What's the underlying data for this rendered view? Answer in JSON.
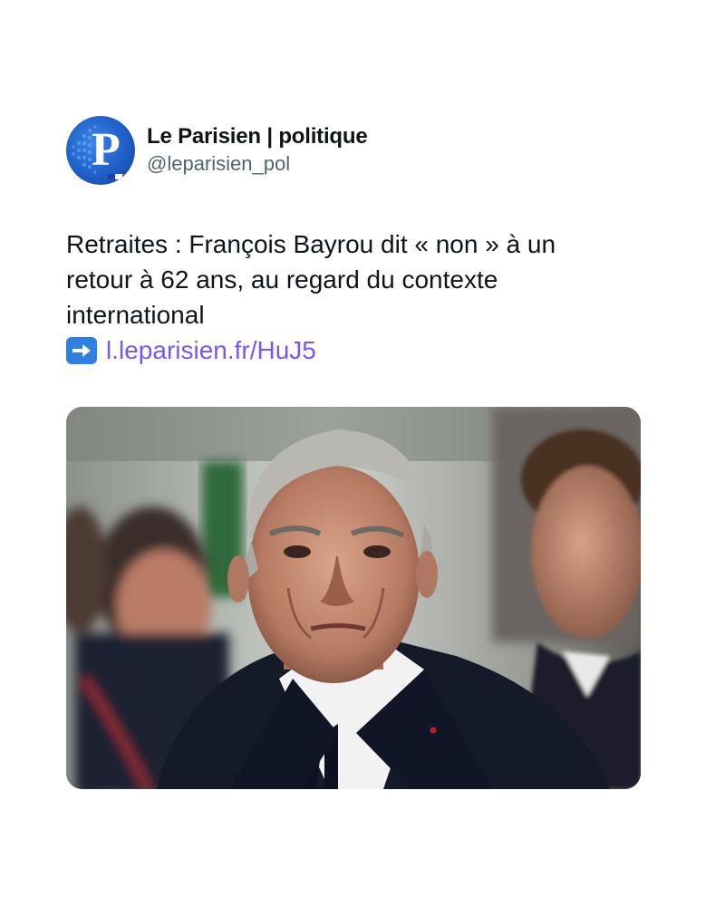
{
  "account": {
    "display_name": "Le Parisien | politique",
    "handle": "@leparisien_pol",
    "avatar_letter": "P",
    "avatar_icon": "le-parisien-logo-icon",
    "brand_color": "#1f5fc8"
  },
  "tweet": {
    "text": "Retraites : François Bayrou dit « non » à un retour à 62 ans, au regard du contexte international",
    "link_emoji": "right-arrow-emoji-icon",
    "link_text": "l.leparisien.fr/HuJ5",
    "link_color": "#7856ff"
  },
  "media": {
    "description_icon": "news-photo"
  }
}
